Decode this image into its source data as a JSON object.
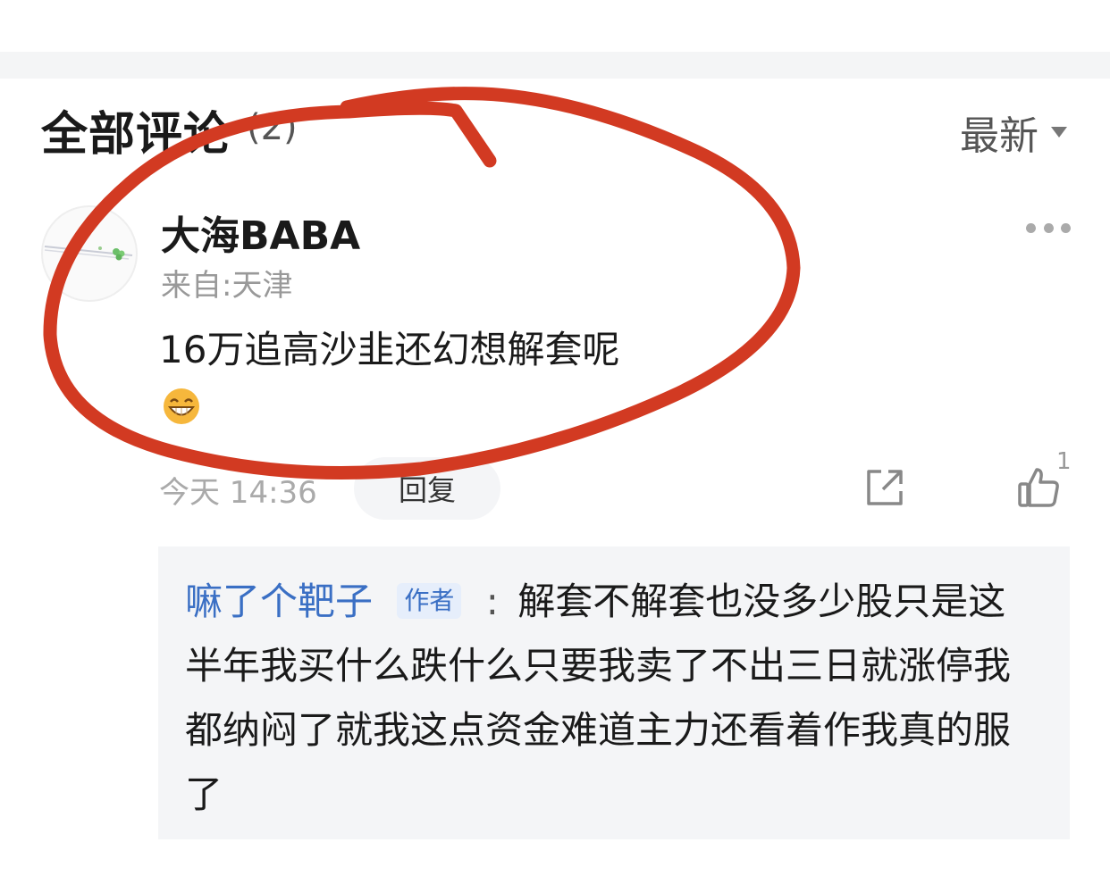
{
  "comments_section": {
    "title": "全部评论",
    "count": "(2)",
    "sort_label": "最新",
    "icons": {
      "sort": "caret-down-icon",
      "more": "more-dots-icon",
      "share": "share-icon",
      "like": "thumbs-up-icon",
      "emoji": "grinning-emoji-icon"
    }
  },
  "comment": {
    "author": "大海BABA",
    "location": "来自:天津",
    "text": "16万追高沙韭还幻想解套呢",
    "timestamp": "今天 14:36",
    "reply_label": "回复",
    "like_count": "1"
  },
  "reply": {
    "user": "嘛了个靶子",
    "author_tag": "作者",
    "colon": ":",
    "text": "解套不解套也没多少股只是这半年我买什么跌什么只要我卖了不出三日就涨停我都纳闷了就我这点资金难道主力还看着作我真的服了"
  },
  "colors": {
    "background": "#ffffff",
    "link_blue": "#3a6fc4",
    "reply_bg": "#f4f5f7",
    "annotation_red": "#d23a22"
  }
}
